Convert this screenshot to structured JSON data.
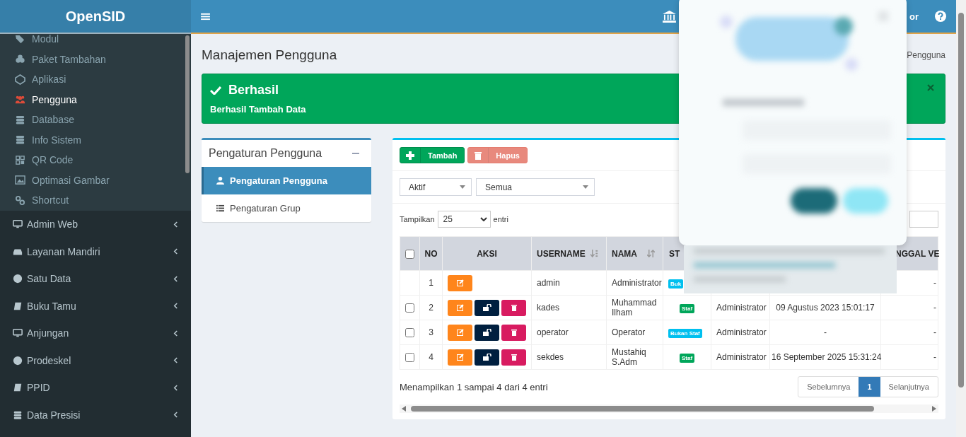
{
  "brand": "OpenSID",
  "header": {
    "user_fragment": "or"
  },
  "sidebar": {
    "submenu": [
      {
        "label": "Modul",
        "selected": false
      },
      {
        "label": "Paket Tambahan",
        "selected": false
      },
      {
        "label": "Aplikasi",
        "selected": false
      },
      {
        "label": "Pengguna",
        "selected": true
      },
      {
        "label": "Database",
        "selected": false
      },
      {
        "label": "Info Sistem",
        "selected": false
      },
      {
        "label": "QR Code",
        "selected": false
      },
      {
        "label": "Optimasi Gambar",
        "selected": false
      },
      {
        "label": "Shortcut",
        "selected": false
      }
    ],
    "items": [
      {
        "label": "Admin Web",
        "expanded": false
      },
      {
        "label": "Layanan Mandiri",
        "expanded": false
      },
      {
        "label": "Satu Data",
        "expanded": false
      },
      {
        "label": "Buku Tamu",
        "expanded": false
      },
      {
        "label": "Anjungan",
        "expanded": false
      },
      {
        "label": "Prodeskel",
        "expanded": false
      },
      {
        "label": "PPID",
        "expanded": false
      },
      {
        "label": "Data Presisi",
        "expanded": false
      }
    ]
  },
  "page_title": "Manajemen Pengguna",
  "breadcrumb": "Pengguna",
  "alert": {
    "title": "Berhasil",
    "message": "Berhasil Tambah Data"
  },
  "settings_box": {
    "title": "Pengaturan Pengguna",
    "items": [
      {
        "label": "Pengaturan Pengguna",
        "selected": true
      },
      {
        "label": "Pengaturan Grup",
        "selected": false
      }
    ]
  },
  "toolbar": [
    {
      "label": "Tambah",
      "kind": "add",
      "disabled": false
    },
    {
      "label": "Hapus",
      "kind": "delete",
      "disabled": true
    }
  ],
  "filters": [
    {
      "value": "Aktif"
    },
    {
      "value": "Semua"
    }
  ],
  "page_size": {
    "label": "Tampilkan",
    "value": "25",
    "suffix": "entri"
  },
  "table": {
    "header": {
      "no": "NO",
      "aksi": "AKSI",
      "username": "USERNAME",
      "nama": "NAMA",
      "status": "ST",
      "column_9": "NGGAL VE"
    },
    "header_checked": false,
    "rows": [
      {
        "no": "1",
        "actions": [
          {
            "kind": "edit"
          }
        ],
        "username": "admin",
        "nama": "Administrator",
        "status": {
          "text": "Buk",
          "kind": "non-staff"
        },
        "column_9": "-"
      },
      {
        "checked": false,
        "no": "2",
        "actions": [
          {
            "kind": "edit"
          },
          {
            "kind": "lock"
          },
          {
            "kind": "delete"
          }
        ],
        "username": "kades",
        "nama": "Muhammad Ilham",
        "status": {
          "text": "Staf",
          "kind": "staff"
        },
        "group": "Administrator",
        "date": "09 Agustus 2023 15:01:17",
        "column_9": "-"
      },
      {
        "checked": false,
        "no": "3",
        "actions": [
          {
            "kind": "edit"
          },
          {
            "kind": "lock"
          },
          {
            "kind": "delete"
          }
        ],
        "username": "operator",
        "nama": "Operator",
        "status": {
          "text": "Bukan Staf",
          "kind": "non-staff"
        },
        "group": "Administrator",
        "date": "-",
        "column_9": "-"
      },
      {
        "checked": false,
        "no": "4",
        "actions": [
          {
            "kind": "edit"
          },
          {
            "kind": "lock"
          },
          {
            "kind": "delete"
          }
        ],
        "username": "sekdes",
        "nama": "Mustahiq S.Adm",
        "status": {
          "text": "Staf",
          "kind": "staff"
        },
        "group": "Administrator",
        "date": "16 September 2025 15:31:24",
        "column_9": "-"
      }
    ]
  },
  "info": "Menampilkan 1 sampai 4 dari 4 entri",
  "pagination": [
    {
      "label": "Sebelumnya",
      "selected": false
    },
    {
      "label": "1",
      "selected": true
    },
    {
      "label": "Selanjutnya",
      "selected": false
    }
  ]
}
